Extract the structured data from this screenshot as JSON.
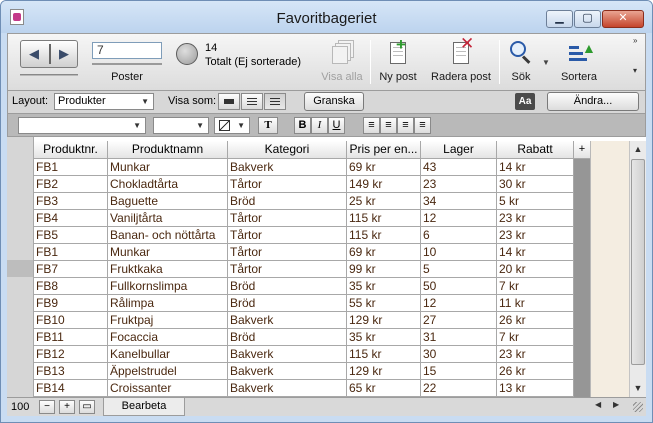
{
  "window": {
    "title": "Favoritbageriet",
    "minimize_icon": "minimize-icon",
    "maximize_icon": "maximize-icon",
    "close_icon": "close-icon"
  },
  "toolbar": {
    "record_value": "7",
    "records_label": "Poster",
    "found_count": "14",
    "found_label": "Totalt (Ej sorterade)",
    "show_all_label": "Visa alla",
    "new_record_label": "Ny post",
    "delete_record_label": "Radera post",
    "find_label": "Sök",
    "sort_label": "Sortera"
  },
  "layoutbar": {
    "layout_label": "Layout:",
    "layout_value": "Produkter",
    "view_as_label": "Visa som:",
    "preview_label": "Granska",
    "edit_label": "Ändra..."
  },
  "formatbar": {
    "bold_label": "B",
    "italic_label": "I",
    "underline_label": "U",
    "text_tool_label": "T"
  },
  "table": {
    "columns": [
      "Produktnr.",
      "Produktnamn",
      "Kategori",
      "Pris per en...",
      "Lager",
      "Rabatt"
    ],
    "add_column_label": "+",
    "rows": [
      [
        "FB1",
        "Munkar",
        "Bakverk",
        "69 kr",
        "43",
        "14 kr"
      ],
      [
        "FB2",
        "Chokladtårta",
        "Tårtor",
        "149 kr",
        "23",
        "30 kr"
      ],
      [
        "FB3",
        "Baguette",
        "Bröd",
        "25 kr",
        "34",
        "5 kr"
      ],
      [
        "FB4",
        "Vaniljtårta",
        "Tårtor",
        "115 kr",
        "12",
        "23 kr"
      ],
      [
        "FB5",
        "Banan- och nöttårta",
        "Tårtor",
        "115 kr",
        "6",
        "23 kr"
      ],
      [
        "FB1",
        "Munkar",
        "Tårtor",
        "69 kr",
        "10",
        "14 kr"
      ],
      [
        "FB7",
        "Fruktkaka",
        "Tårtor",
        "99 kr",
        "5",
        "20 kr"
      ],
      [
        "FB8",
        "Fullkornslimpa",
        "Bröd",
        "35 kr",
        "50",
        "7 kr"
      ],
      [
        "FB9",
        "Rålimpa",
        "Bröd",
        "55 kr",
        "12",
        "11 kr"
      ],
      [
        "FB10",
        "Fruktpaj",
        "Bakverk",
        "129 kr",
        "27",
        "26 kr"
      ],
      [
        "FB11",
        "Focaccia",
        "Bröd",
        "35 kr",
        "31",
        "7 kr"
      ],
      [
        "FB12",
        "Kanelbullar",
        "Bakverk",
        "115 kr",
        "30",
        "23 kr"
      ],
      [
        "FB13",
        "Äppelstrudel",
        "Bakverk",
        "129 kr",
        "15",
        "26 kr"
      ],
      [
        "FB14",
        "Croissanter",
        "Bakverk",
        "65 kr",
        "22",
        "13 kr"
      ]
    ]
  },
  "statusbar": {
    "zoom": "100",
    "mode_label": "Bearbeta"
  }
}
